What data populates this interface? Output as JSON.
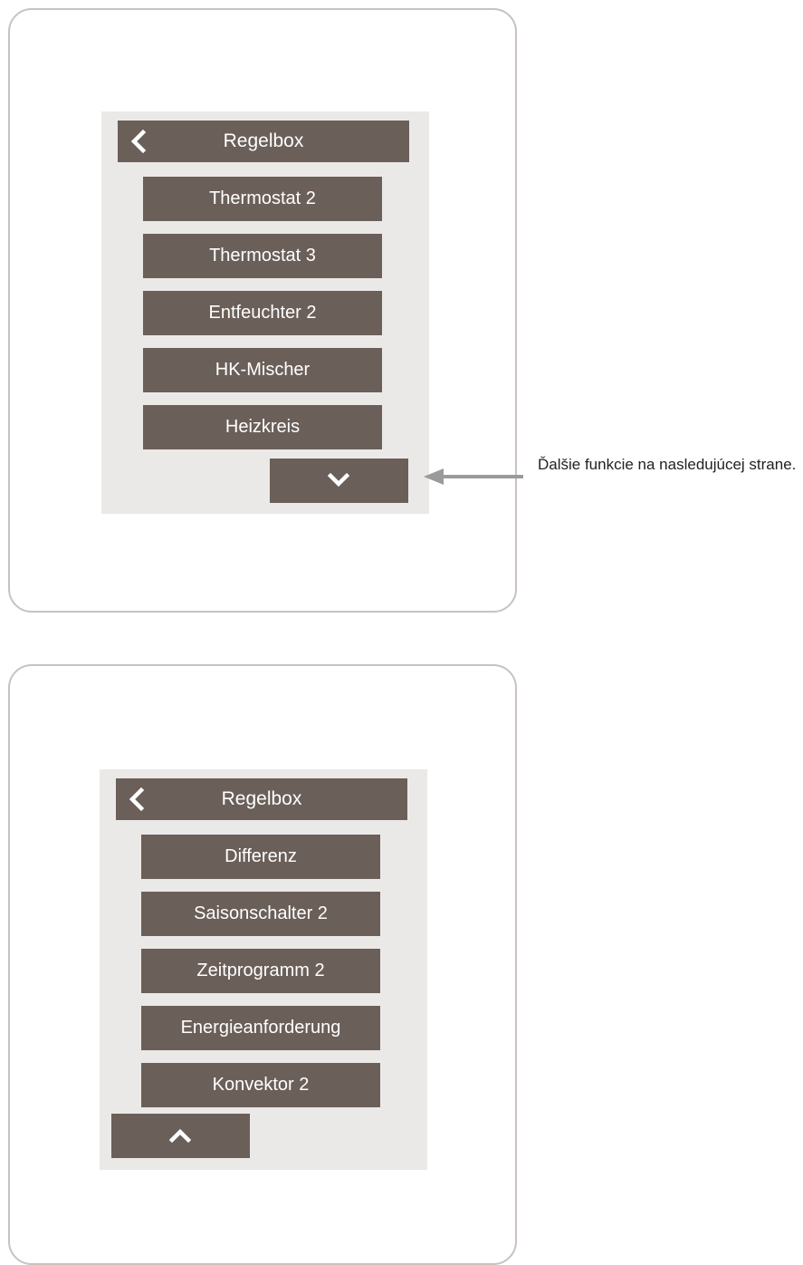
{
  "screens": [
    {
      "header": {
        "back_icon": "chevron-left-icon",
        "title": "Regelbox"
      },
      "menu_items": [
        "Thermostat 2",
        "Thermostat 3",
        "Entfeuchter 2",
        "HK-Mischer",
        "Heizkreis"
      ],
      "nav_button": {
        "icon": "chevron-down-icon"
      }
    },
    {
      "header": {
        "back_icon": "chevron-left-icon",
        "title": "Regelbox"
      },
      "menu_items": [
        "Differenz",
        "Saisonschalter 2",
        "Zeitprogramm 2",
        "Energieanforderung",
        "Konvektor 2"
      ],
      "nav_button": {
        "icon": "chevron-up-icon"
      }
    }
  ],
  "annotation": {
    "text": "Ďalšie funkcie na nasledujúcej strane.",
    "arrow_icon": "arrow-left-icon"
  },
  "colors": {
    "button_fill": "#6b5f59",
    "panel_background": "#ebe9e8",
    "device_border": "#c9c2be",
    "arrow": "#9a9a9a"
  }
}
